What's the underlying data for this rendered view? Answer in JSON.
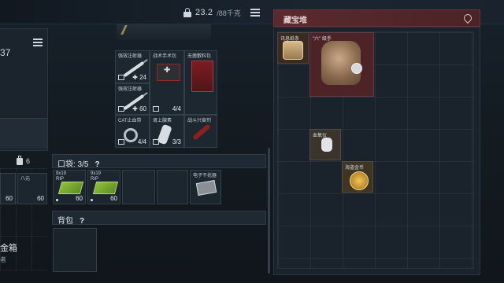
{
  "topbar": {
    "weight_value": "23.2",
    "weight_unit": "/88千克"
  },
  "left": {
    "number": "37",
    "chip_title": "金箱",
    "chip_subtitle": "者",
    "six_count": "6",
    "slot_values": [
      "60",
      "60"
    ],
    "slot_label": "八元"
  },
  "vest": {
    "cells": [
      {
        "name": "强效注射器",
        "count": "✚ 24"
      },
      {
        "name": "战术手术包",
        "count": "4/4"
      },
      {
        "name": "无菌敷料包",
        "count": ""
      },
      {
        "name": "强效注射器",
        "count": "✚ 60"
      },
      {
        "name": "",
        "count": ""
      },
      {
        "name": "",
        "count": ""
      },
      {
        "name": "CAT止血带",
        "count": "4/4"
      },
      {
        "name": "肾上腺素",
        "count": "3/3"
      },
      {
        "name": "战斗兴奋剂",
        "count": ""
      }
    ]
  },
  "pockets": {
    "title": "口袋: 3/5",
    "help": "?",
    "items": [
      {
        "name": "9x19\nRIP",
        "count": "60"
      },
      {
        "name": "9x19\nRIP",
        "count": "60"
      },
      {
        "name": "电子干扰器",
        "count": ""
      }
    ]
  },
  "backpack": {
    "title": "背包",
    "help": "?"
  },
  "stash": {
    "title": "藏宝堆",
    "items": [
      {
        "name": "讯息纸条"
      },
      {
        "name": "\"六\" 级手"
      },
      {
        "name": "血氧仪"
      },
      {
        "name": "海盗金币"
      }
    ]
  },
  "colors": {
    "accent_red": "#5a2a2e",
    "ammo_green": "#8fc23c"
  }
}
